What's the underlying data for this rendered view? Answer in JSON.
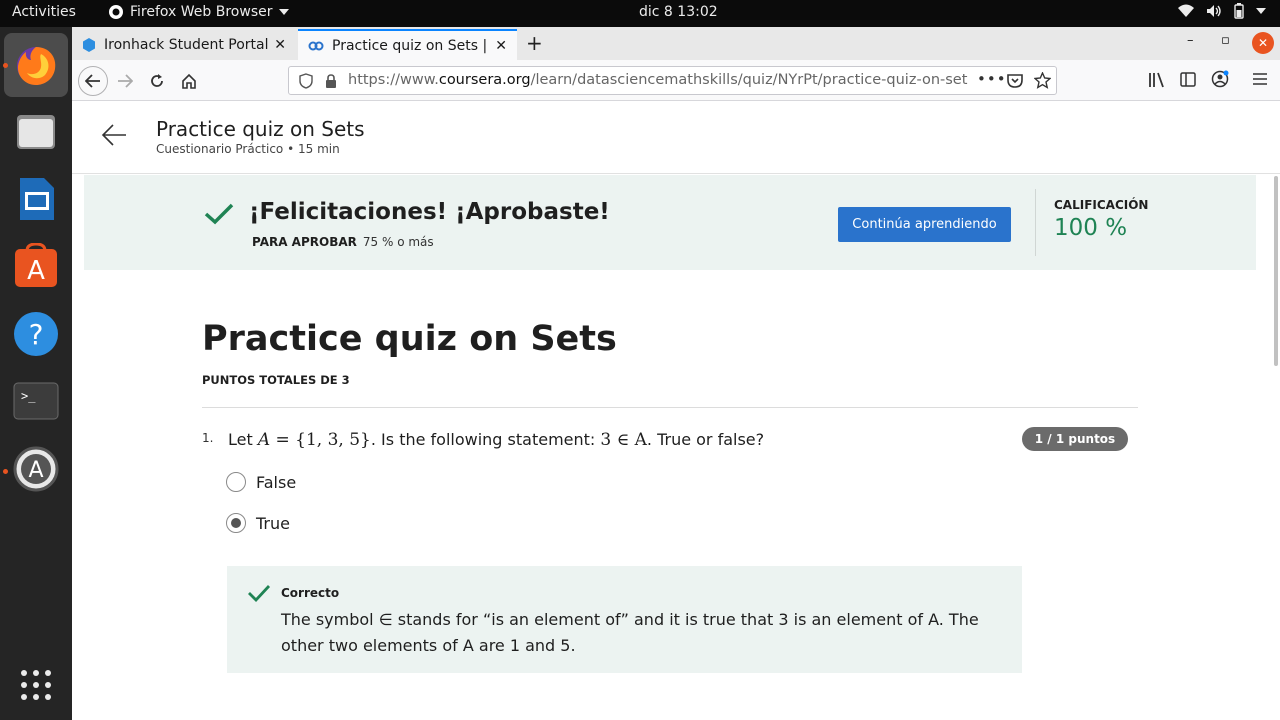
{
  "system": {
    "activities": "Activities",
    "app_name": "Firefox Web Browser",
    "clock": "dic 8  13:02"
  },
  "browser": {
    "tabs": [
      {
        "title": "Ironhack Student Portal",
        "active": false
      },
      {
        "title": "Practice quiz on Sets | Co",
        "active": true
      }
    ],
    "url_prefix": "https://www.",
    "url_domain": "coursera.org",
    "url_path": "/learn/datasciencemathskills/quiz/NYrPt/practice-quiz-on-sets/"
  },
  "header": {
    "title": "Practice quiz on Sets",
    "subtitle": "Cuestionario Práctico • 15 min"
  },
  "banner": {
    "heading": "¡Felicitaciones! ¡Aprobaste!",
    "pass_label": "PARA APROBAR",
    "pass_value": "75 % o más",
    "button": "Continúa aprendiendo",
    "grade_label": "CALIFICACIÓN",
    "grade_value": "100 %",
    "grade_color": "#1f8354"
  },
  "quiz": {
    "title": "Practice quiz on Sets",
    "total_points": "PUNTOS TOTALES DE 3",
    "question": {
      "number": "1.",
      "text_part1": "Let ",
      "set_var": "A",
      "set_def": " = {1, 3, 5}",
      "text_part2": ". Is the following statement: ",
      "statement": "3 ∈ A",
      "text_part3": ". True or false?",
      "points": "1 / 1 puntos",
      "options": [
        {
          "label": "False",
          "selected": false
        },
        {
          "label": "True",
          "selected": true
        }
      ],
      "feedback": {
        "label": "Correcto",
        "text": "The symbol ∈ stands for “is an element of” and it is true that 3 is an element of A. The other two elements of A are 1 and 5."
      }
    }
  },
  "colors": {
    "accent_blue": "#2a73cc",
    "success_green": "#1f8354",
    "banner_bg": "#ecf3f1"
  }
}
